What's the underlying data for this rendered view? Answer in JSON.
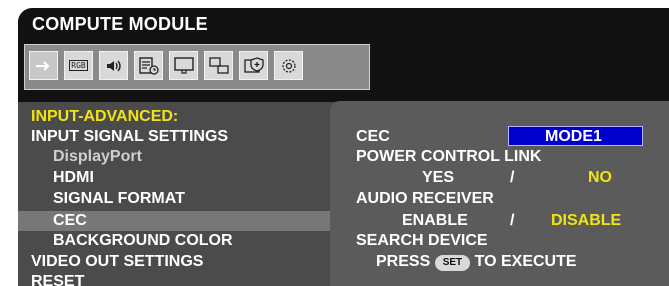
{
  "header": {
    "title": "COMPUTE MODULE"
  },
  "icon_bar": [
    {
      "icon": "input-arrow-icon"
    },
    {
      "icon": "rgb-picture-icon",
      "text": "RGB"
    },
    {
      "icon": "audio-speaker-icon"
    },
    {
      "icon": "schedule-list-icon"
    },
    {
      "icon": "display-monitor-icon"
    },
    {
      "icon": "multi-display-icon"
    },
    {
      "icon": "protect-shield-icon"
    },
    {
      "icon": "system-settings-icon"
    }
  ],
  "left_menu": {
    "section_title": "INPUT-ADVANCED:",
    "items": [
      {
        "label": "INPUT SIGNAL SETTINGS"
      },
      {
        "label": "DisplayPort"
      },
      {
        "label": "HDMI"
      },
      {
        "label": "SIGNAL FORMAT"
      },
      {
        "label": "CEC"
      },
      {
        "label": "BACKGROUND COLOR"
      },
      {
        "label": "VIDEO OUT SETTINGS"
      },
      {
        "label": "RESET"
      }
    ]
  },
  "right_panel": {
    "cec": {
      "label": "CEC",
      "value": "MODE1"
    },
    "power_control_link": {
      "label": "POWER CONTROL LINK",
      "option_yes": "YES",
      "separator": "/",
      "option_no": "NO"
    },
    "audio_receiver": {
      "label": "AUDIO RECEIVER",
      "option_enable": "ENABLE",
      "separator": "/",
      "option_disable": "DISABLE"
    },
    "search_device": {
      "label": "SEARCH DEVICE",
      "press": "PRESS",
      "set_button": "SET",
      "to_execute": "TO EXECUTE"
    }
  },
  "colors": {
    "background": "#111111",
    "highlight_text": "#f1e414",
    "selected_value_box": "#0000cc",
    "left_panel": "#4b4b4b",
    "right_panel": "#5b5b5b"
  }
}
